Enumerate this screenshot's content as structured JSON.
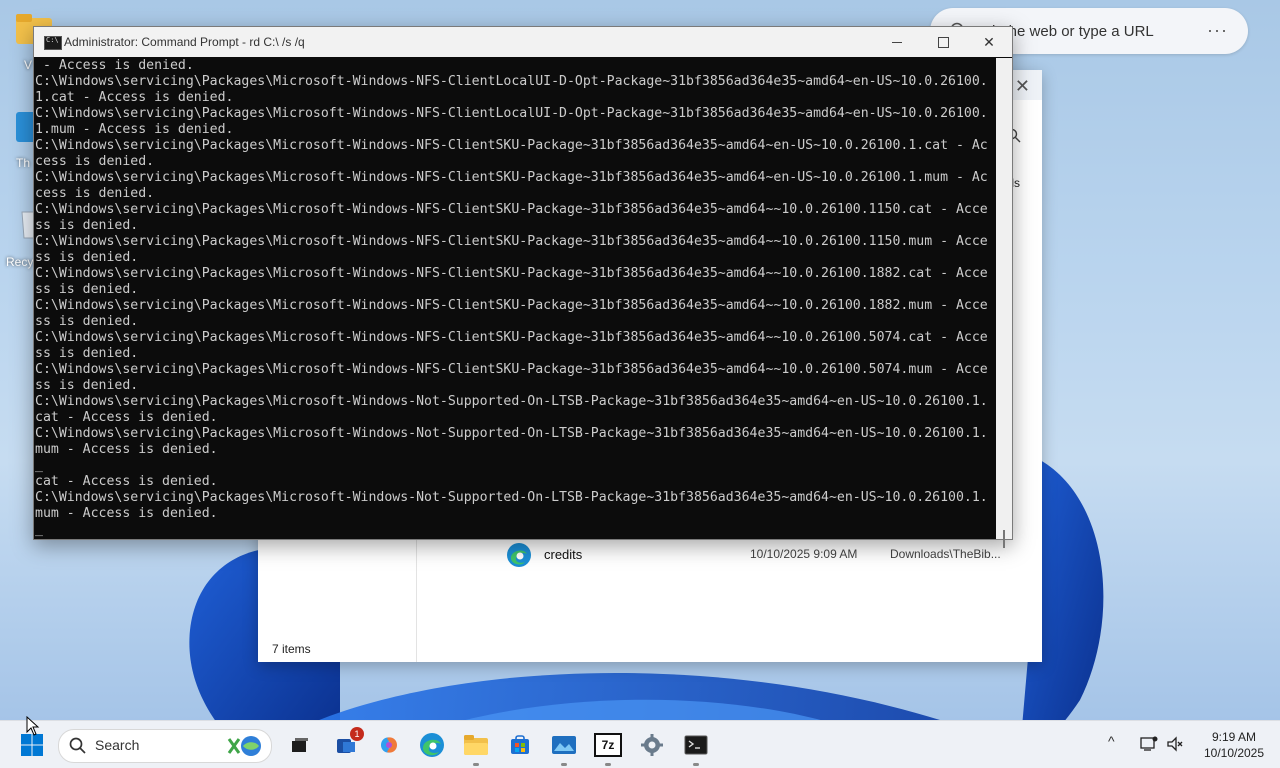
{
  "desktop": {
    "labels": [
      "V",
      "Th",
      "Recy"
    ]
  },
  "browser": {
    "placeholder": "Search the web or type a URL",
    "visible_text": "h the web or type a URL",
    "more": "···"
  },
  "explorer": {
    "close": "✕",
    "side_text": "ls",
    "file": {
      "name": "credits",
      "date": "10/10/2025 9:09 AM",
      "location": "Downloads\\TheBib..."
    },
    "status": "7 items"
  },
  "cmd": {
    "title": "Administrator: Command Prompt - rd  C:\\ /s /q",
    "close": "✕",
    "lines": [
      " - Access is denied.",
      "C:\\Windows\\servicing\\Packages\\Microsoft-Windows-NFS-ClientLocalUI-D-Opt-Package~31bf3856ad364e35~amd64~en-US~10.0.26100.",
      "1.cat - Access is denied.",
      "C:\\Windows\\servicing\\Packages\\Microsoft-Windows-NFS-ClientLocalUI-D-Opt-Package~31bf3856ad364e35~amd64~en-US~10.0.26100.",
      "1.mum - Access is denied.",
      "C:\\Windows\\servicing\\Packages\\Microsoft-Windows-NFS-ClientSKU-Package~31bf3856ad364e35~amd64~en-US~10.0.26100.1.cat - Ac",
      "cess is denied.",
      "C:\\Windows\\servicing\\Packages\\Microsoft-Windows-NFS-ClientSKU-Package~31bf3856ad364e35~amd64~en-US~10.0.26100.1.mum - Ac",
      "cess is denied.",
      "C:\\Windows\\servicing\\Packages\\Microsoft-Windows-NFS-ClientSKU-Package~31bf3856ad364e35~amd64~~10.0.26100.1150.cat - Acce",
      "ss is denied.",
      "C:\\Windows\\servicing\\Packages\\Microsoft-Windows-NFS-ClientSKU-Package~31bf3856ad364e35~amd64~~10.0.26100.1150.mum - Acce",
      "ss is denied.",
      "C:\\Windows\\servicing\\Packages\\Microsoft-Windows-NFS-ClientSKU-Package~31bf3856ad364e35~amd64~~10.0.26100.1882.cat - Acce",
      "ss is denied.",
      "C:\\Windows\\servicing\\Packages\\Microsoft-Windows-NFS-ClientSKU-Package~31bf3856ad364e35~amd64~~10.0.26100.1882.mum - Acce",
      "ss is denied.",
      "C:\\Windows\\servicing\\Packages\\Microsoft-Windows-NFS-ClientSKU-Package~31bf3856ad364e35~amd64~~10.0.26100.5074.cat - Acce",
      "ss is denied.",
      "C:\\Windows\\servicing\\Packages\\Microsoft-Windows-NFS-ClientSKU-Package~31bf3856ad364e35~amd64~~10.0.26100.5074.mum - Acce",
      "ss is denied.",
      "C:\\Windows\\servicing\\Packages\\Microsoft-Windows-Not-Supported-On-LTSB-Package~31bf3856ad364e35~amd64~en-US~10.0.26100.1.",
      "cat - Access is denied.",
      "C:\\Windows\\servicing\\Packages\\Microsoft-Windows-Not-Supported-On-LTSB-Package~31bf3856ad364e35~amd64~en-US~10.0.26100.1.",
      "mum - Access is denied.",
      "_",
      "cat - Access is denied.",
      "C:\\Windows\\servicing\\Packages\\Microsoft-Windows-Not-Supported-On-LTSB-Package~31bf3856ad364e35~amd64~en-US~10.0.26100.1.",
      "mum - Access is denied.",
      "_"
    ]
  },
  "taskbar": {
    "search_label": "Search",
    "mail_badge": "1",
    "zip_label": "7z",
    "time": "9:19 AM",
    "date": "10/10/2025",
    "chevron": "^"
  },
  "colors": {
    "accent": "#0078d4",
    "console_bg": "#0c0c0c",
    "console_text": "#cccccc"
  }
}
